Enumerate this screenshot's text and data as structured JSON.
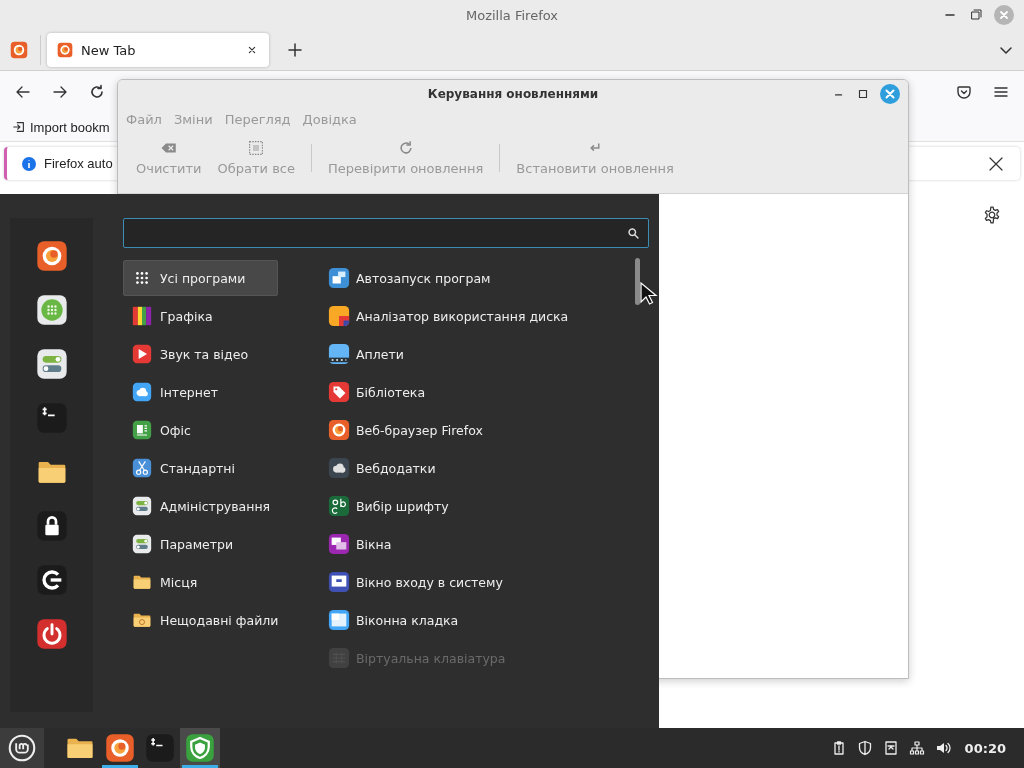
{
  "browser": {
    "title": "Mozilla Firefox",
    "tabs": [
      {
        "label": "New Tab",
        "selected": true
      }
    ],
    "bookmarks": [
      "Import bookm"
    ],
    "notification": "Firefox auto"
  },
  "update_manager": {
    "title": "Керування оновленнями",
    "menu": [
      "Файл",
      "Зміни",
      "Перегляд",
      "Довідка"
    ],
    "toolbar": [
      {
        "kind": "clear",
        "label": "Очистити"
      },
      {
        "kind": "select_all",
        "label": "Обрати все"
      },
      {
        "kind": "refresh",
        "label": "Перевірити оновлення"
      },
      {
        "kind": "install",
        "label": "Встановити оновлення"
      }
    ]
  },
  "start_menu": {
    "favorites": [
      {
        "kind": "firefox"
      },
      {
        "kind": "apps"
      },
      {
        "kind": "toggles"
      },
      {
        "kind": "terminal"
      },
      {
        "kind": "folder"
      },
      {
        "kind": "lock"
      },
      {
        "kind": "logout"
      },
      {
        "kind": "power"
      }
    ],
    "categories": [
      {
        "kind": "all",
        "label": "Усі програми",
        "selected": true
      },
      {
        "kind": "graphics",
        "label": "Графіка",
        "selected": false
      },
      {
        "kind": "video",
        "label": "Звук та відео",
        "selected": false
      },
      {
        "kind": "internet",
        "label": "Інтернет",
        "selected": false
      },
      {
        "kind": "office",
        "label": "Офіс",
        "selected": false
      },
      {
        "kind": "scissors",
        "label": "Стандартні",
        "selected": false
      },
      {
        "kind": "toggles",
        "label": "Адміністрування",
        "selected": false
      },
      {
        "kind": "toggles",
        "label": "Параметри",
        "selected": false
      },
      {
        "kind": "folder",
        "label": "Місця",
        "selected": false
      },
      {
        "kind": "recent",
        "label": "Нещодавні файли",
        "selected": false
      }
    ],
    "apps": [
      {
        "kind": "autostart",
        "label": "Автозапуск програм",
        "disabled": false
      },
      {
        "kind": "disk",
        "label": "Аналізатор використання диска",
        "disabled": false
      },
      {
        "kind": "applets",
        "label": "Аплети",
        "disabled": false
      },
      {
        "kind": "library",
        "label": "Бібліотека",
        "disabled": false
      },
      {
        "kind": "firefox",
        "label": "Веб-браузер Firefox",
        "disabled": false
      },
      {
        "kind": "webapps",
        "label": "Вебдодатки",
        "disabled": false
      },
      {
        "kind": "fonts",
        "label": "Вибір шрифту",
        "disabled": false
      },
      {
        "kind": "windows",
        "label": "Вікна",
        "disabled": false
      },
      {
        "kind": "login",
        "label": "Вікно входу в систему",
        "disabled": false
      },
      {
        "kind": "workspace",
        "label": "Віконна кладка",
        "disabled": false
      },
      {
        "kind": "keyboard",
        "label": "Віртуальна клавіатура",
        "disabled": true
      }
    ]
  },
  "taskbar": {
    "launchers": [
      {
        "kind": "folder",
        "running": false,
        "selected": false
      },
      {
        "kind": "firefox",
        "running": true,
        "selected": false
      },
      {
        "kind": "terminal",
        "running": false,
        "selected": false
      },
      {
        "kind": "shield",
        "running": true,
        "selected": true
      }
    ],
    "clock": "00:20"
  }
}
